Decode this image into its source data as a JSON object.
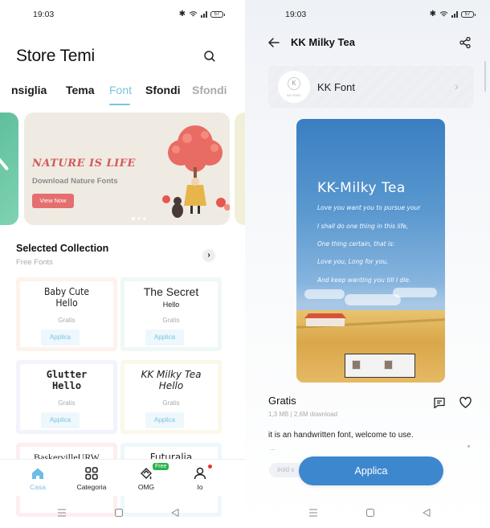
{
  "status_bar": {
    "time": "19:03",
    "battery": "57"
  },
  "left": {
    "title": "Store Temi",
    "tabs": [
      {
        "label": "Consiglia",
        "visible_text": "nsiglia"
      },
      {
        "label": "Tema"
      },
      {
        "label": "Font",
        "active": true
      },
      {
        "label": "Sfondi"
      },
      {
        "label": "Sfondi"
      }
    ],
    "banner": {
      "headline": "NATURE IS LIFE",
      "subtitle": "Download Nature Fonts",
      "cta": "View Now",
      "page_count": 3,
      "active_page": 1
    },
    "collection": {
      "title": "Selected Collection",
      "subtitle": "Free Fonts",
      "cards": [
        {
          "preview_line1": "Baby Cute",
          "preview_line2": "Hello",
          "price": "Gratis",
          "action": "Applica"
        },
        {
          "preview_line1": "The Secret",
          "preview_line2": "Hello",
          "price": "Gratis",
          "action": "Applica"
        },
        {
          "preview_line1": "Glutter",
          "preview_line2": "Hello",
          "price": "Gratis",
          "action": "Applica"
        },
        {
          "preview_line1": "KK Milky Tea",
          "preview_line2": "Hello",
          "price": "Gratis",
          "action": "Applica"
        },
        {
          "preview_line1": "BaskervilleURW"
        },
        {
          "preview_line1": "Futuralia"
        }
      ]
    },
    "bottom_nav": [
      {
        "label": "Casa",
        "icon": "home-icon",
        "active": true
      },
      {
        "label": "Categoria",
        "icon": "grid-icon"
      },
      {
        "label": "OMG",
        "icon": "paint-bucket-icon",
        "badge": "Free"
      },
      {
        "label": "Io",
        "icon": "user-icon",
        "notification": true
      }
    ]
  },
  "right": {
    "title": "KK Milky Tea",
    "author": {
      "name": "KK Font",
      "avatar_letter": "K",
      "avatar_caption": "KK FONT"
    },
    "preview": {
      "title": "KK-Milky Tea",
      "lines": [
        "Love you want you to pursue your",
        "I shall do one thing in this life,",
        "One thing certain, that is:",
        "Love you, Long for you,",
        "And keep wanting you till I die."
      ]
    },
    "price": "Gratis",
    "size": "1,3 MB",
    "downloads": "2,6M download",
    "description": "it is an handwritten font, welcome to use.",
    "description_more": "...",
    "tag": "#old s",
    "apply_label": "Applica"
  },
  "colors": {
    "accent": "#7cc2e3",
    "apply_button": "#3d87cf",
    "banner_cta": "#e46f6f",
    "free_badge": "#2bb24c"
  }
}
